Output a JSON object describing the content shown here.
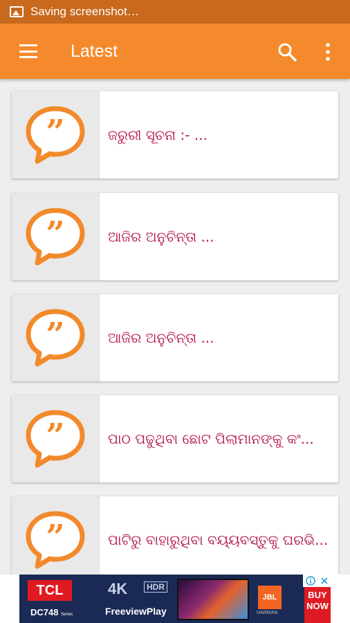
{
  "status_bar": {
    "text": "Saving screenshot…"
  },
  "app_bar": {
    "title": "Latest"
  },
  "articles": [
    {
      "title": "ଜରୁରୀ ସୂଚନା :- ..."
    },
    {
      "title": "ଆଜିର ଅନୁଚିନ୍ତା  ..."
    },
    {
      "title": " ଆଜିର ଅନୁଚିନ୍ତା ..."
    },
    {
      "title": "ପାଠ ପଢୁଥିବା ଛୋଟ ପିଲାମାନଙ୍କୁ କଂ..."
    },
    {
      "title": "ପାଟିରୁ ବାହାରୁଥିବା ବୟ୍ୟବସ୍ତୁକୁ ଘରଭି..."
    }
  ],
  "ad": {
    "brand": "TCL",
    "model": "DC748",
    "model_sub": "Series",
    "res": "4K",
    "hdr": "HDR",
    "freeview": "FreeviewPlay",
    "jbl": "JBL",
    "harman": "HARMAN",
    "cta": "BUY NOW"
  },
  "colors": {
    "status": "#c8691e",
    "appbar": "#f58a2c",
    "title_text": "#b5174c",
    "quote_icon": "#f28a2c"
  }
}
